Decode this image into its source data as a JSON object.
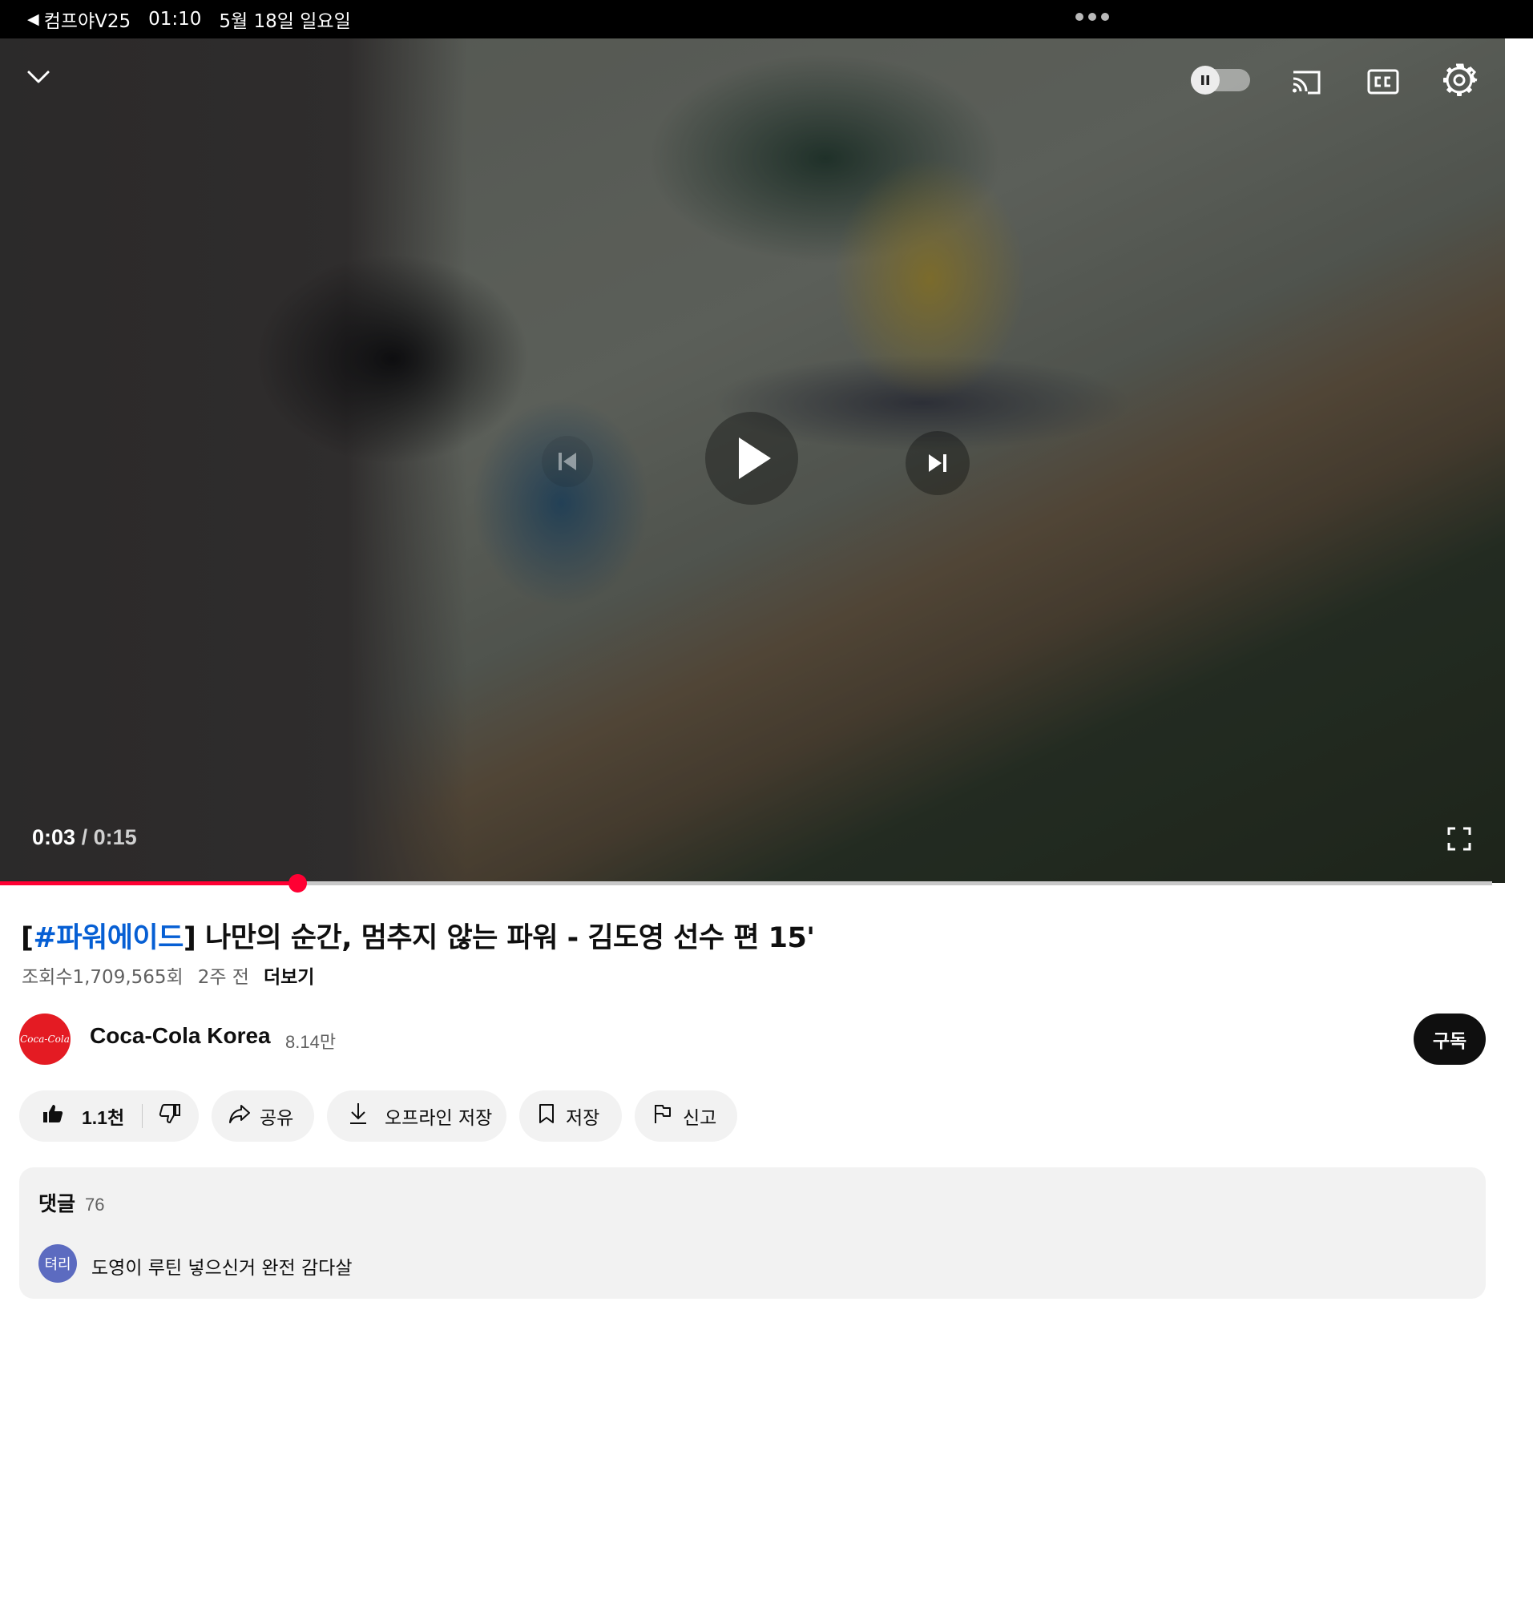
{
  "status_bar": {
    "back_app": "컴프야V25",
    "time": "01:10",
    "date": "5월 18일 일요일"
  },
  "player": {
    "current_time": "0:03",
    "separator": "/",
    "duration": "0:15",
    "progress_fraction": 0.2,
    "accent_color": "#ff0033",
    "icons": {
      "collapse": "chevron-down-icon",
      "autoplay": "autoplay-toggle-icon",
      "cast": "cast-icon",
      "captions": "cc-icon",
      "settings": "gear-icon",
      "previous": "skip-previous-icon",
      "play": "play-icon",
      "next": "skip-next-icon",
      "fullscreen": "fullscreen-icon"
    }
  },
  "video": {
    "title_hashtag": "#파워에이드",
    "title_open_bracket": "[",
    "title_rest": "] 나만의 순간, 멈추지 않는 파워 - 김도영 선수 편 15'",
    "views": "조회수1,709,565회",
    "age": "2주 전",
    "more_label": "더보기",
    "hashtag_color": "#065fd4"
  },
  "channel": {
    "name": "Coca-Cola Korea",
    "subscribers": "8.14만",
    "avatar_logo_text": "Coca-Cola",
    "subscribe_label": "구독"
  },
  "actions": {
    "like_count": "1.1천",
    "share_label": "공유",
    "download_label": "오프라인 저장",
    "save_label": "저장",
    "report_label": "신고"
  },
  "comments": {
    "label": "댓글",
    "count": "76",
    "top_comment": {
      "avatar_text": "텨리",
      "text": "도영이 루틴 넣으신거 완전 감다살"
    }
  }
}
